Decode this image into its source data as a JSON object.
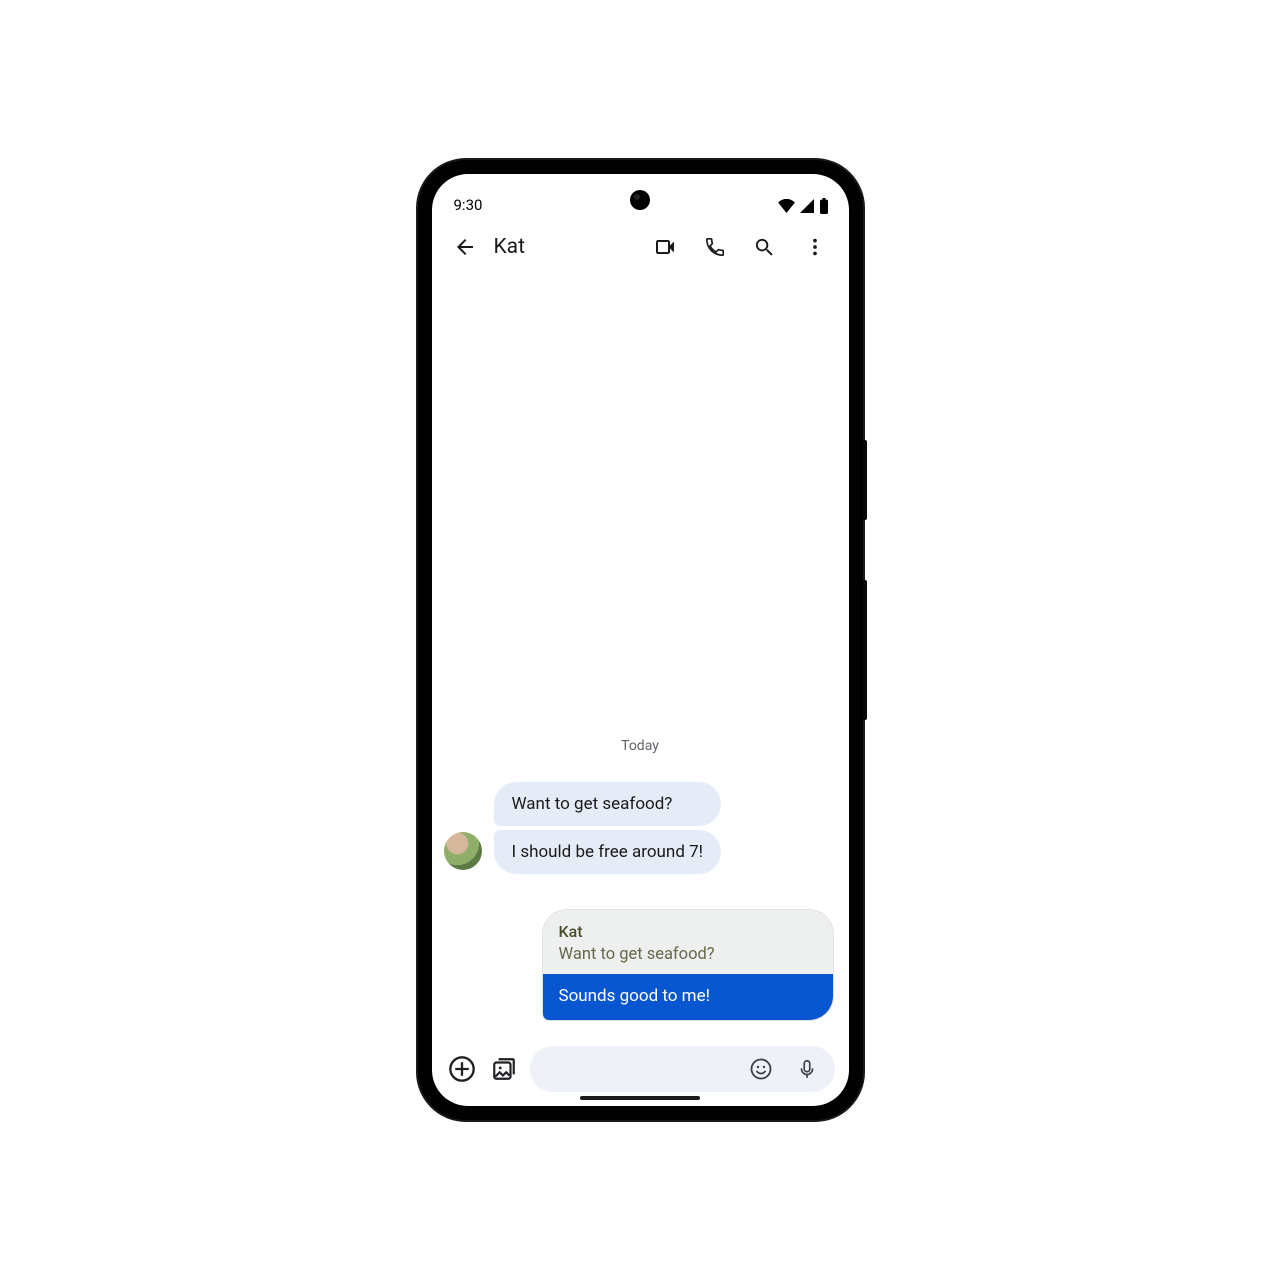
{
  "status": {
    "time": "9:30"
  },
  "header": {
    "title": "Kat"
  },
  "date_separator": "Today",
  "incoming": [
    "Want to get seafood?",
    "I should be free around 7!"
  ],
  "reply": {
    "quoted_sender": "Kat",
    "quoted_text": "Want to get seafood?",
    "body": "Sounds good to me!"
  }
}
